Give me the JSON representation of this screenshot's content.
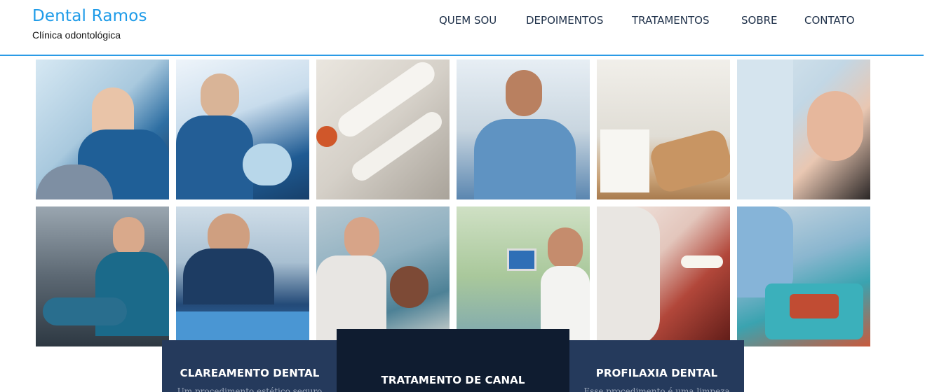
{
  "header": {
    "brand_title": "Dental Ramos",
    "brand_subtitle": "Clínica odontológica",
    "nav": [
      {
        "label": "QUEM SOU"
      },
      {
        "label": "DEPOIMENTOS"
      },
      {
        "label": "TRATAMENTOS"
      },
      {
        "label": "SOBRE"
      },
      {
        "label": "CONTATO"
      }
    ]
  },
  "gallery": {
    "photos": [
      {
        "subject": "dentist-treating-patient-photo"
      },
      {
        "subject": "dentist-with-loupes-photo"
      },
      {
        "subject": "dental-handpieces-photo"
      },
      {
        "subject": "smiling-dentist-photo"
      },
      {
        "subject": "dental-office-chair-photo"
      },
      {
        "subject": "patient-smiling-exam-photo"
      },
      {
        "subject": "dentist-at-chair-photo"
      },
      {
        "subject": "dentist-procedure-photo"
      },
      {
        "subject": "dentist-and-patient-photo"
      },
      {
        "subject": "dentist-office-green-photo"
      },
      {
        "subject": "teeth-closeup-instruments-photo"
      },
      {
        "subject": "dental-tools-tray-photo"
      }
    ]
  },
  "cards": [
    {
      "title": "CLAREAMENTO DENTAL",
      "text": "Um procedimento estético seguro"
    },
    {
      "title": "TRATAMENTO DE CANAL",
      "text": ""
    },
    {
      "title": "PROFILAXIA DENTAL",
      "text": "Esse procedimento é uma limpeza"
    }
  ],
  "colors": {
    "brand": "#1e9be8",
    "nav_text": "#1d2f48",
    "card_bg": "#253a5c",
    "card_featured_bg": "#0f1c30"
  }
}
